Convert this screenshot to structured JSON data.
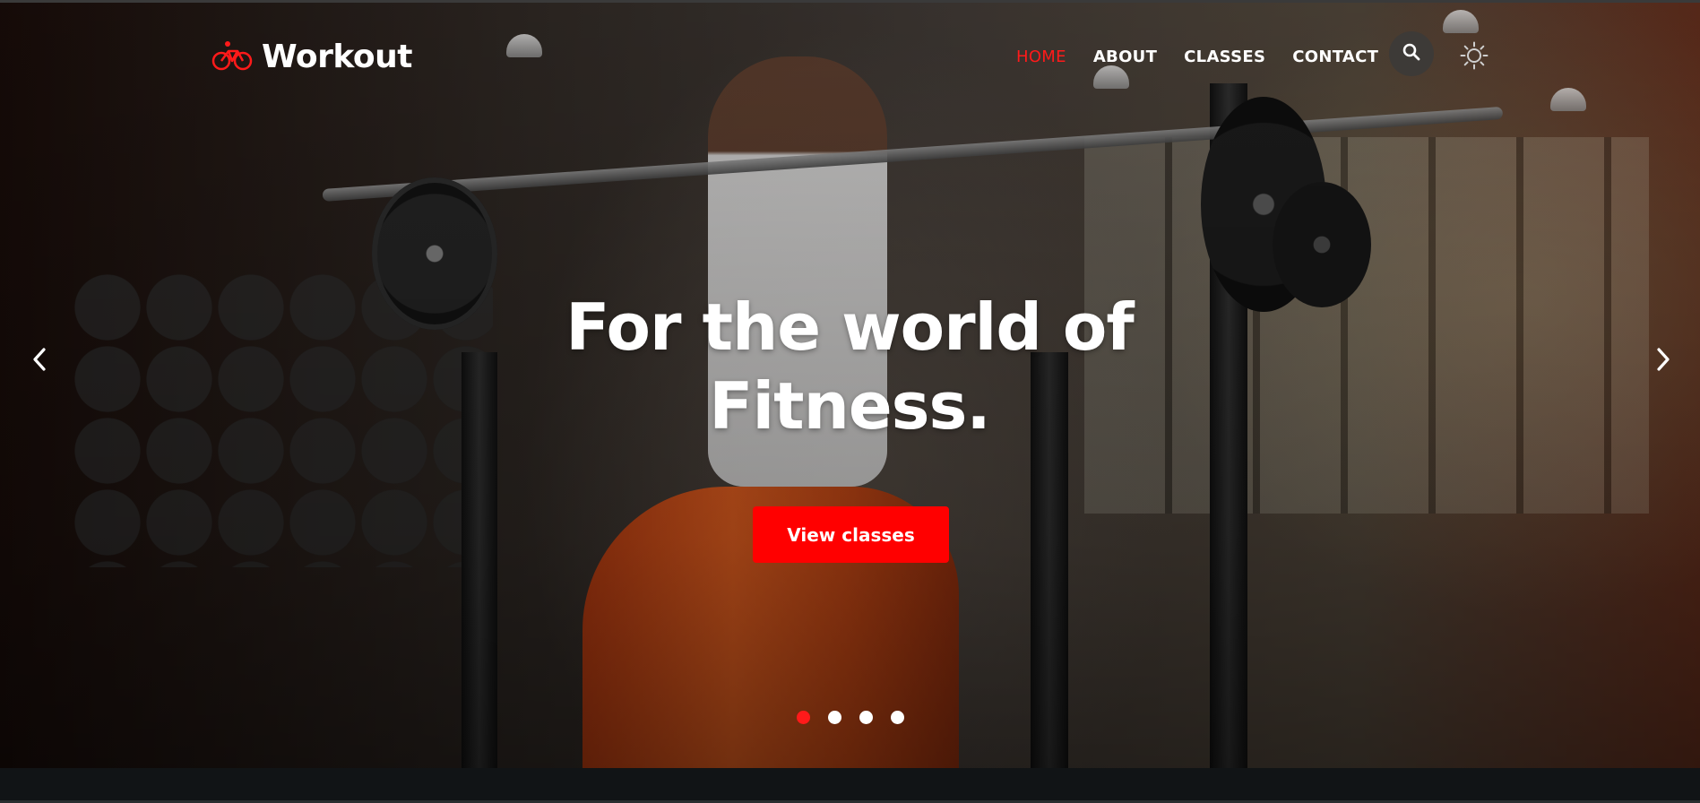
{
  "brand": {
    "name": "Workout",
    "icon": "bicycle-icon",
    "accent": "#ff0000"
  },
  "nav": {
    "items": [
      {
        "label": "HOME",
        "active": true
      },
      {
        "label": "ABOUT",
        "active": false
      },
      {
        "label": "CLASSES",
        "active": false
      },
      {
        "label": "CONTACT",
        "active": false
      }
    ],
    "search_icon": "search-icon",
    "theme_icon": "sun-icon"
  },
  "hero": {
    "headline_line1": "For the world of",
    "headline_line2": "Fitness.",
    "cta_label": "View classes",
    "prev_icon": "chevron-left-icon",
    "next_icon": "chevron-right-icon",
    "slides_total": 4,
    "active_slide": 1
  }
}
